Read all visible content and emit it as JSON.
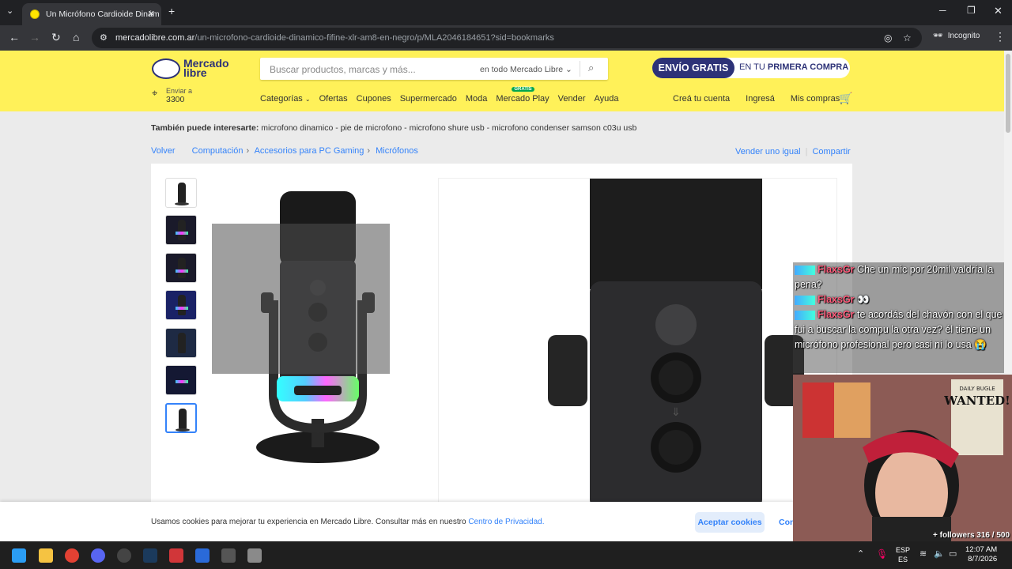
{
  "browser": {
    "tab_title": "Un Micrófono Cardioide Dinám",
    "url_domain": "mercadolibre.com.ar",
    "url_path": "/un-microfono-cardioide-dinamico-fifine-xlr-am8-en-negro/p/MLA2046184651?sid=bookmarks",
    "incognito_label": "Incognito"
  },
  "header": {
    "logo_text_1": "Mercado",
    "logo_text_2": "libre",
    "search_placeholder": "Buscar productos, marcas y más...",
    "search_scope": "en todo Mercado Libre",
    "promo_badge": "ENVÍO GRATIS",
    "promo_text_1": "EN TU",
    "promo_text_2": "PRIMERA COMPRA",
    "location_line1": "Enviar a",
    "location_line2": "3300",
    "nav": [
      "Categorías",
      "Ofertas",
      "Cupones",
      "Supermercado",
      "Moda",
      "Mercado Play",
      "Vender",
      "Ayuda"
    ],
    "gratis_tag": "GRATIS",
    "user_nav": [
      "Creá tu cuenta",
      "Ingresá",
      "Mis compras"
    ]
  },
  "related": {
    "label": "También puede interesarte:",
    "items": "microfono dinamico - pie de microfono - microfono shure usb - microfono condenser samson c03u usb"
  },
  "breadcrumbs": {
    "back": "Volver",
    "items": [
      "Computación",
      "Accesorios para PC Gaming",
      "Micrófonos"
    ],
    "sell_same": "Vender uno igual",
    "share": "Compartir"
  },
  "cookie": {
    "message": "Usamos cookies para mejorar tu experiencia en Mercado Libre. Consultar más en nuestro",
    "link": "Centro de Privacidad.",
    "accept": "Aceptar cookies",
    "configure": "Con"
  },
  "chat": [
    {
      "user": "FlaxsGr",
      "text": "Che un mic por 20mil valdría la pena?"
    },
    {
      "user": "FlaxsGr",
      "text": "👀"
    },
    {
      "user": "FlaxsGr",
      "text": "te acordás del chavón con el que fui a buscar la compu la otra vez? él tiene un micrófono profesional pero casi ni lo usa 😭"
    }
  ],
  "stream": {
    "followers": "followers 316 / 500",
    "poster_title": "WANTED!",
    "poster_header": "DAILY BUGLE"
  },
  "taskbar": {
    "lang1": "ESP",
    "lang2": "ES",
    "time": "12:07 AM",
    "date": "8/7/2026"
  },
  "colors": {
    "ml_yellow": "#fff159",
    "ml_blue": "#3483fa",
    "ml_navy": "#2d3277",
    "chrome_dark": "#202124"
  }
}
